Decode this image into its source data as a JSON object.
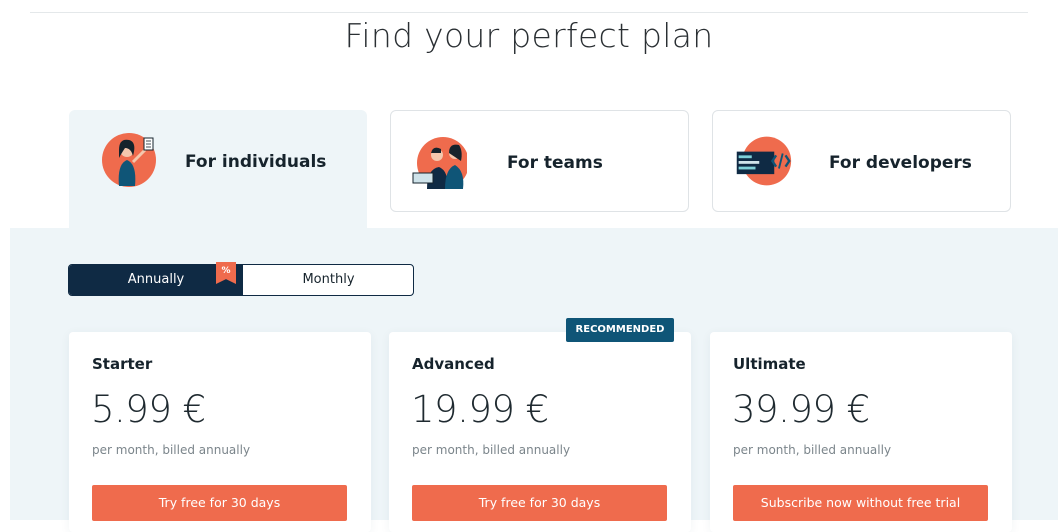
{
  "header": {
    "title": "Find your perfect plan"
  },
  "tabs": [
    {
      "label": "For individuals",
      "active": true,
      "icon": "individual-illustration-icon"
    },
    {
      "label": "For teams",
      "active": false,
      "icon": "team-illustration-icon"
    },
    {
      "label": "For developers",
      "active": false,
      "icon": "developer-illustration-icon"
    }
  ],
  "billing_toggle": {
    "options": [
      "Annually",
      "Monthly"
    ],
    "selected": "Annually",
    "discount_badge": "%"
  },
  "plans": [
    {
      "name": "Starter",
      "price": "5.99 €",
      "billing": "per month, billed annually",
      "cta": "Try free for 30 days"
    },
    {
      "name": "Advanced",
      "price": "19.99 €",
      "billing": "per month, billed annually",
      "cta": "Try free for 30 days",
      "badge": "RECOMMENDED"
    },
    {
      "name": "Ultimate",
      "price": "39.99 €",
      "billing": "per month, billed annually",
      "cta": "Subscribe now without free trial"
    }
  ],
  "colors": {
    "accent": "#ef6b4d",
    "navy": "#0f2a44",
    "badge": "#0f5577",
    "panel": "#eef5f8"
  }
}
